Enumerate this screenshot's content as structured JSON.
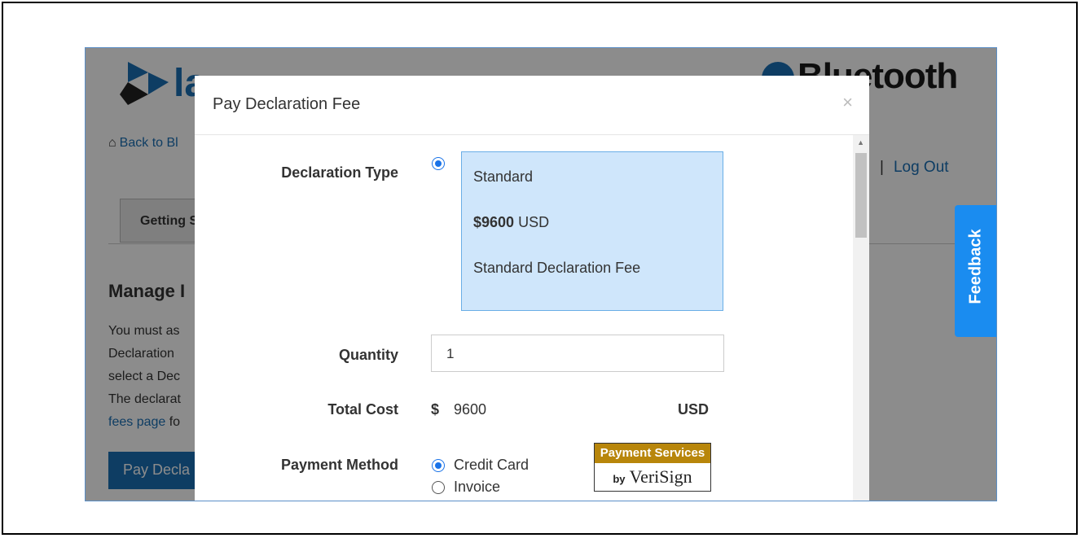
{
  "background": {
    "logo_text": "la",
    "bt_logo": "Bluetooth",
    "back_link": "Back to Bl",
    "logout": {
      "sep": "|",
      "label": "Log Out"
    },
    "tab_getting": "Getting S",
    "manage_title": "Manage I",
    "para_lines": [
      "You must as",
      "Declaration",
      "select a Dec",
      "The declarat"
    ],
    "para_link": "fees page",
    "para_link_rest": " fo",
    "pay_button": "Pay Decla"
  },
  "feedback": "Feedback",
  "modal": {
    "title": "Pay Declaration Fee",
    "close": "×",
    "declaration_type": {
      "label": "Declaration Type",
      "option": {
        "name": "Standard",
        "price": "$9600",
        "currency": "USD",
        "description": "Standard Declaration Fee"
      }
    },
    "quantity": {
      "label": "Quantity",
      "value": "1"
    },
    "total_cost": {
      "label": "Total Cost",
      "symbol": "$",
      "value": "9600",
      "currency": "USD"
    },
    "payment_method": {
      "label": "Payment Method",
      "options": [
        "Credit Card",
        "Invoice"
      ],
      "selected": "Credit Card",
      "badge_top": "Payment Services",
      "badge_by": "by",
      "badge_brand": "VeriSign"
    }
  }
}
